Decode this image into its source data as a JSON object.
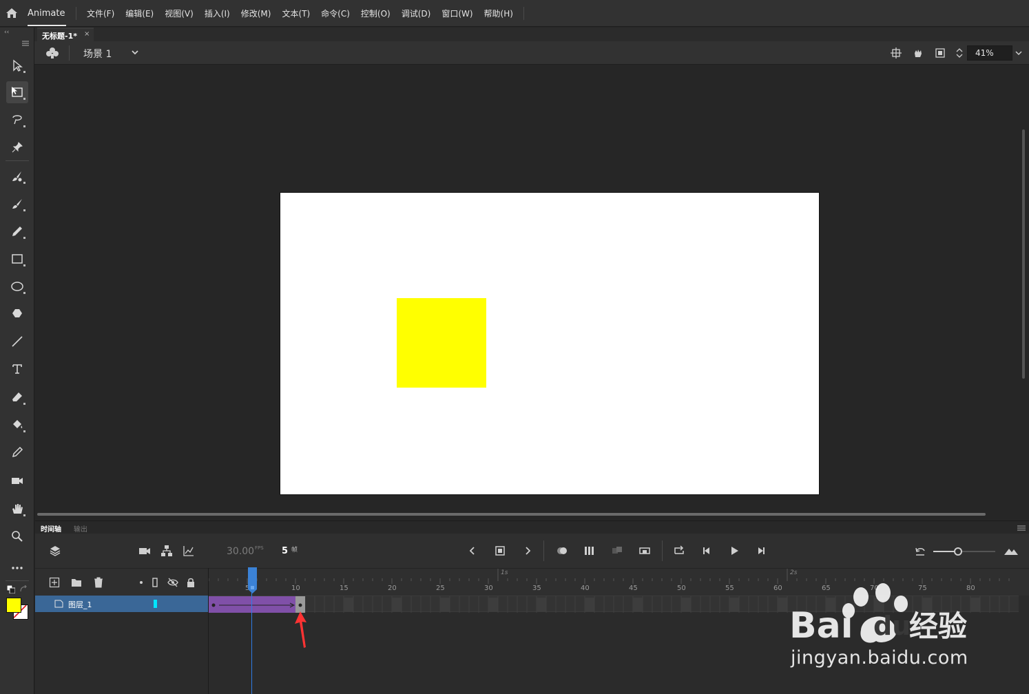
{
  "menubar": {
    "app_name": "Animate",
    "items": [
      "文件(F)",
      "编辑(E)",
      "视图(V)",
      "插入(I)",
      "修改(M)",
      "文本(T)",
      "命令(C)",
      "控制(O)",
      "调试(D)",
      "窗口(W)",
      "帮助(H)"
    ]
  },
  "document": {
    "tab_title": "无标题-1*",
    "close_glyph": "×"
  },
  "scene": {
    "label": "场景 1",
    "zoom": "41%"
  },
  "colors": {
    "fill": "#ffff00",
    "stroke": "#ffffff",
    "stage": "#ffffff",
    "tween": "#8050a8",
    "layer_highlight": "#3a6797",
    "layer_color_tag": "#00e5ff",
    "playhead": "#2f7ce6"
  },
  "toolbar": {
    "tools": [
      "selection-tool",
      "free-transform-tool",
      "lasso-tool",
      "pin-tool",
      "fluid-brush-tool",
      "paint-brush-tool",
      "pencil-tool",
      "rectangle-tool",
      "oval-tool",
      "polystar-tool",
      "line-tool",
      "text-tool",
      "eraser-tool",
      "paint-bucket-tool",
      "eyedropper-tool",
      "camera-tool",
      "hand-tool",
      "zoom-tool",
      "more-tools"
    ]
  },
  "timeline": {
    "tab_timeline": "时间轴",
    "tab_output": "输出",
    "fps": "30.00",
    "fps_unit": "FPS",
    "current_frame": "5",
    "frame_unit": "帧",
    "ruler_labels": [
      "5",
      "10",
      "15",
      "20",
      "25",
      "30",
      "35",
      "40",
      "45",
      "50",
      "55",
      "60",
      "65",
      "70",
      "75",
      "80"
    ],
    "seconds_labels": [
      "1s",
      "2s"
    ],
    "layer_name": "图层_1",
    "tween_start_frame": 1,
    "tween_end_frame": 10
  },
  "watermark": {
    "brand": "Bai",
    "brand2": "du",
    "product": "经验",
    "url": "jingyan.baidu.com"
  }
}
